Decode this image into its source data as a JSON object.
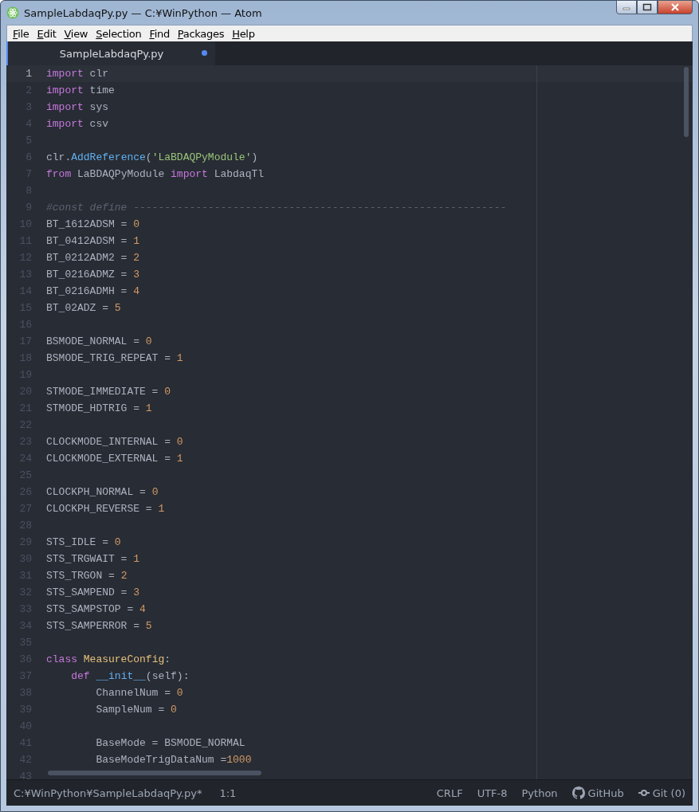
{
  "window": {
    "title": "SampleLabdaqPy.py — C:¥WinPython — Atom"
  },
  "menu": [
    "File",
    "Edit",
    "View",
    "Selection",
    "Find",
    "Packages",
    "Help"
  ],
  "tabs": [
    {
      "label": "SampleLabdaqPy.py",
      "selected": true,
      "modified": true
    }
  ],
  "editor": {
    "lines": [
      {
        "number": "1",
        "selected": true,
        "tokens": [
          {
            "kind": "keyword",
            "text": "import"
          },
          {
            "kind": "plain",
            "text": " clr"
          }
        ]
      },
      {
        "number": "2",
        "selected": false,
        "tokens": [
          {
            "kind": "keyword",
            "text": "import"
          },
          {
            "kind": "plain",
            "text": " time"
          }
        ]
      },
      {
        "number": "3",
        "selected": false,
        "tokens": [
          {
            "kind": "keyword",
            "text": "import"
          },
          {
            "kind": "plain",
            "text": " sys"
          }
        ]
      },
      {
        "number": "4",
        "selected": false,
        "tokens": [
          {
            "kind": "keyword",
            "text": "import"
          },
          {
            "kind": "plain",
            "text": " csv"
          }
        ]
      },
      {
        "number": "5",
        "selected": false
      },
      {
        "number": "6",
        "selected": false,
        "tokens": [
          {
            "kind": "plain",
            "text": "clr."
          },
          {
            "kind": "function",
            "text": "AddReference"
          },
          {
            "kind": "plain",
            "text": "("
          },
          {
            "kind": "string",
            "text": "'LaBDAQPyModule'"
          },
          {
            "kind": "plain",
            "text": ")"
          }
        ]
      },
      {
        "number": "7",
        "selected": false,
        "tokens": [
          {
            "kind": "keyword",
            "text": "from"
          },
          {
            "kind": "plain",
            "text": " LaBDAQPyModule "
          },
          {
            "kind": "keyword",
            "text": "import"
          },
          {
            "kind": "plain",
            "text": " LabdaqTl"
          }
        ]
      },
      {
        "number": "8",
        "selected": false
      },
      {
        "number": "9",
        "selected": false,
        "tokens": [
          {
            "kind": "comment",
            "text": "#const define ------------------------------------------------------------"
          }
        ]
      },
      {
        "number": "10",
        "selected": false,
        "tokens": [
          {
            "kind": "plain",
            "text": "BT_1612ADSM = "
          },
          {
            "kind": "number",
            "text": "0"
          }
        ]
      },
      {
        "number": "11",
        "selected": false,
        "tokens": [
          {
            "kind": "plain",
            "text": "BT_0412ADSM = "
          },
          {
            "kind": "number",
            "text": "1"
          }
        ]
      },
      {
        "number": "12",
        "selected": false,
        "tokens": [
          {
            "kind": "plain",
            "text": "BT_0212ADM2 = "
          },
          {
            "kind": "number",
            "text": "2"
          }
        ]
      },
      {
        "number": "13",
        "selected": false,
        "tokens": [
          {
            "kind": "plain",
            "text": "BT_0216ADMZ = "
          },
          {
            "kind": "number",
            "text": "3"
          }
        ]
      },
      {
        "number": "14",
        "selected": false,
        "tokens": [
          {
            "kind": "plain",
            "text": "BT_0216ADMH = "
          },
          {
            "kind": "number",
            "text": "4"
          }
        ]
      },
      {
        "number": "15",
        "selected": false,
        "tokens": [
          {
            "kind": "plain",
            "text": "BT_02ADZ = "
          },
          {
            "kind": "number",
            "text": "5"
          }
        ]
      },
      {
        "number": "16",
        "selected": false
      },
      {
        "number": "17",
        "selected": false,
        "tokens": [
          {
            "kind": "plain",
            "text": "BSMODE_NORMAL = "
          },
          {
            "kind": "number",
            "text": "0"
          }
        ]
      },
      {
        "number": "18",
        "selected": false,
        "tokens": [
          {
            "kind": "plain",
            "text": "BSMODE_TRIG_REPEAT = "
          },
          {
            "kind": "number",
            "text": "1"
          }
        ]
      },
      {
        "number": "19",
        "selected": false
      },
      {
        "number": "20",
        "selected": false,
        "tokens": [
          {
            "kind": "plain",
            "text": "STMODE_IMMEDIATE = "
          },
          {
            "kind": "number",
            "text": "0"
          }
        ]
      },
      {
        "number": "21",
        "selected": false,
        "tokens": [
          {
            "kind": "plain",
            "text": "STMODE_HDTRIG = "
          },
          {
            "kind": "number",
            "text": "1"
          }
        ]
      },
      {
        "number": "22",
        "selected": false
      },
      {
        "number": "23",
        "selected": false,
        "tokens": [
          {
            "kind": "plain",
            "text": "CLOCKMODE_INTERNAL = "
          },
          {
            "kind": "number",
            "text": "0"
          }
        ]
      },
      {
        "number": "24",
        "selected": false,
        "tokens": [
          {
            "kind": "plain",
            "text": "CLOCKMODE_EXTERNAL = "
          },
          {
            "kind": "number",
            "text": "1"
          }
        ]
      },
      {
        "number": "25",
        "selected": false
      },
      {
        "number": "26",
        "selected": false,
        "tokens": [
          {
            "kind": "plain",
            "text": "CLOCKPH_NORMAL = "
          },
          {
            "kind": "number",
            "text": "0"
          }
        ]
      },
      {
        "number": "27",
        "selected": false,
        "tokens": [
          {
            "kind": "plain",
            "text": "CLOCKPH_REVERSE = "
          },
          {
            "kind": "number",
            "text": "1"
          }
        ]
      },
      {
        "number": "28",
        "selected": false
      },
      {
        "number": "29",
        "selected": false,
        "tokens": [
          {
            "kind": "plain",
            "text": "STS_IDLE = "
          },
          {
            "kind": "number",
            "text": "0"
          }
        ]
      },
      {
        "number": "30",
        "selected": false,
        "tokens": [
          {
            "kind": "plain",
            "text": "STS_TRGWAIT = "
          },
          {
            "kind": "number",
            "text": "1"
          }
        ]
      },
      {
        "number": "31",
        "selected": false,
        "tokens": [
          {
            "kind": "plain",
            "text": "STS_TRGON = "
          },
          {
            "kind": "number",
            "text": "2"
          }
        ]
      },
      {
        "number": "32",
        "selected": false,
        "tokens": [
          {
            "kind": "plain",
            "text": "STS_SAMPEND = "
          },
          {
            "kind": "number",
            "text": "3"
          }
        ]
      },
      {
        "number": "33",
        "selected": false,
        "tokens": [
          {
            "kind": "plain",
            "text": "STS_SAMPSTOP = "
          },
          {
            "kind": "number",
            "text": "4"
          }
        ]
      },
      {
        "number": "34",
        "selected": false,
        "tokens": [
          {
            "kind": "plain",
            "text": "STS_SAMPERROR = "
          },
          {
            "kind": "number",
            "text": "5"
          }
        ]
      },
      {
        "number": "35",
        "selected": false
      },
      {
        "number": "36",
        "selected": false,
        "tokens": [
          {
            "kind": "keyword",
            "text": "class "
          },
          {
            "kind": "class",
            "text": "MeasureConfig"
          },
          {
            "kind": "plain",
            "text": ":"
          }
        ]
      },
      {
        "number": "37",
        "selected": false,
        "tokens": [
          {
            "kind": "keyword",
            "text": "    def "
          },
          {
            "kind": "function",
            "text": "__init__"
          },
          {
            "kind": "plain",
            "text": "(self):"
          }
        ]
      },
      {
        "number": "38",
        "selected": false,
        "tokens": [
          {
            "kind": "plain",
            "text": "        ChannelNum = "
          },
          {
            "kind": "number",
            "text": "0"
          }
        ]
      },
      {
        "number": "39",
        "selected": false,
        "tokens": [
          {
            "kind": "plain",
            "text": "        SampleNum = "
          },
          {
            "kind": "number",
            "text": "0"
          }
        ]
      },
      {
        "number": "40",
        "selected": false
      },
      {
        "number": "41",
        "selected": false,
        "tokens": [
          {
            "kind": "plain",
            "text": "        BaseMode = BSMODE_NORMAL"
          }
        ]
      },
      {
        "number": "42",
        "selected": false,
        "tokens": [
          {
            "kind": "plain",
            "text": "        BaseModeTrigDataNum ="
          },
          {
            "kind": "number",
            "text": "1000"
          }
        ]
      },
      {
        "number": "43",
        "selected": false
      }
    ]
  },
  "status_bar": {
    "file_path": "C:¥WinPython¥SampleLabdaqPy.py*",
    "cursor": "1:1",
    "line_ending": "CRLF",
    "encoding": "UTF-8",
    "grammar": "Python",
    "github": "GitHub",
    "git": "Git (0)"
  }
}
